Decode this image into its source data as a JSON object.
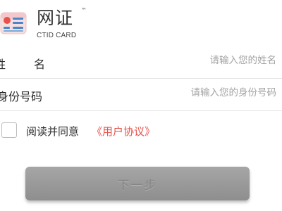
{
  "brand": {
    "name": "网证",
    "trademark": "™",
    "subtitle": "CTID CARD",
    "logo_icon": "id-card-icon"
  },
  "form": {
    "name_row": {
      "label_char_1": "姓",
      "label_char_2": "名",
      "placeholder": "请输入您的姓名",
      "value": ""
    },
    "id_row": {
      "label": "身份号码",
      "placeholder": "请输入您的身份号码",
      "value": ""
    }
  },
  "agreement": {
    "checked": false,
    "text": "阅读并同意",
    "link_text": "《用户协议》",
    "link_color": "#e8524a"
  },
  "actions": {
    "next_label": "下一步"
  }
}
